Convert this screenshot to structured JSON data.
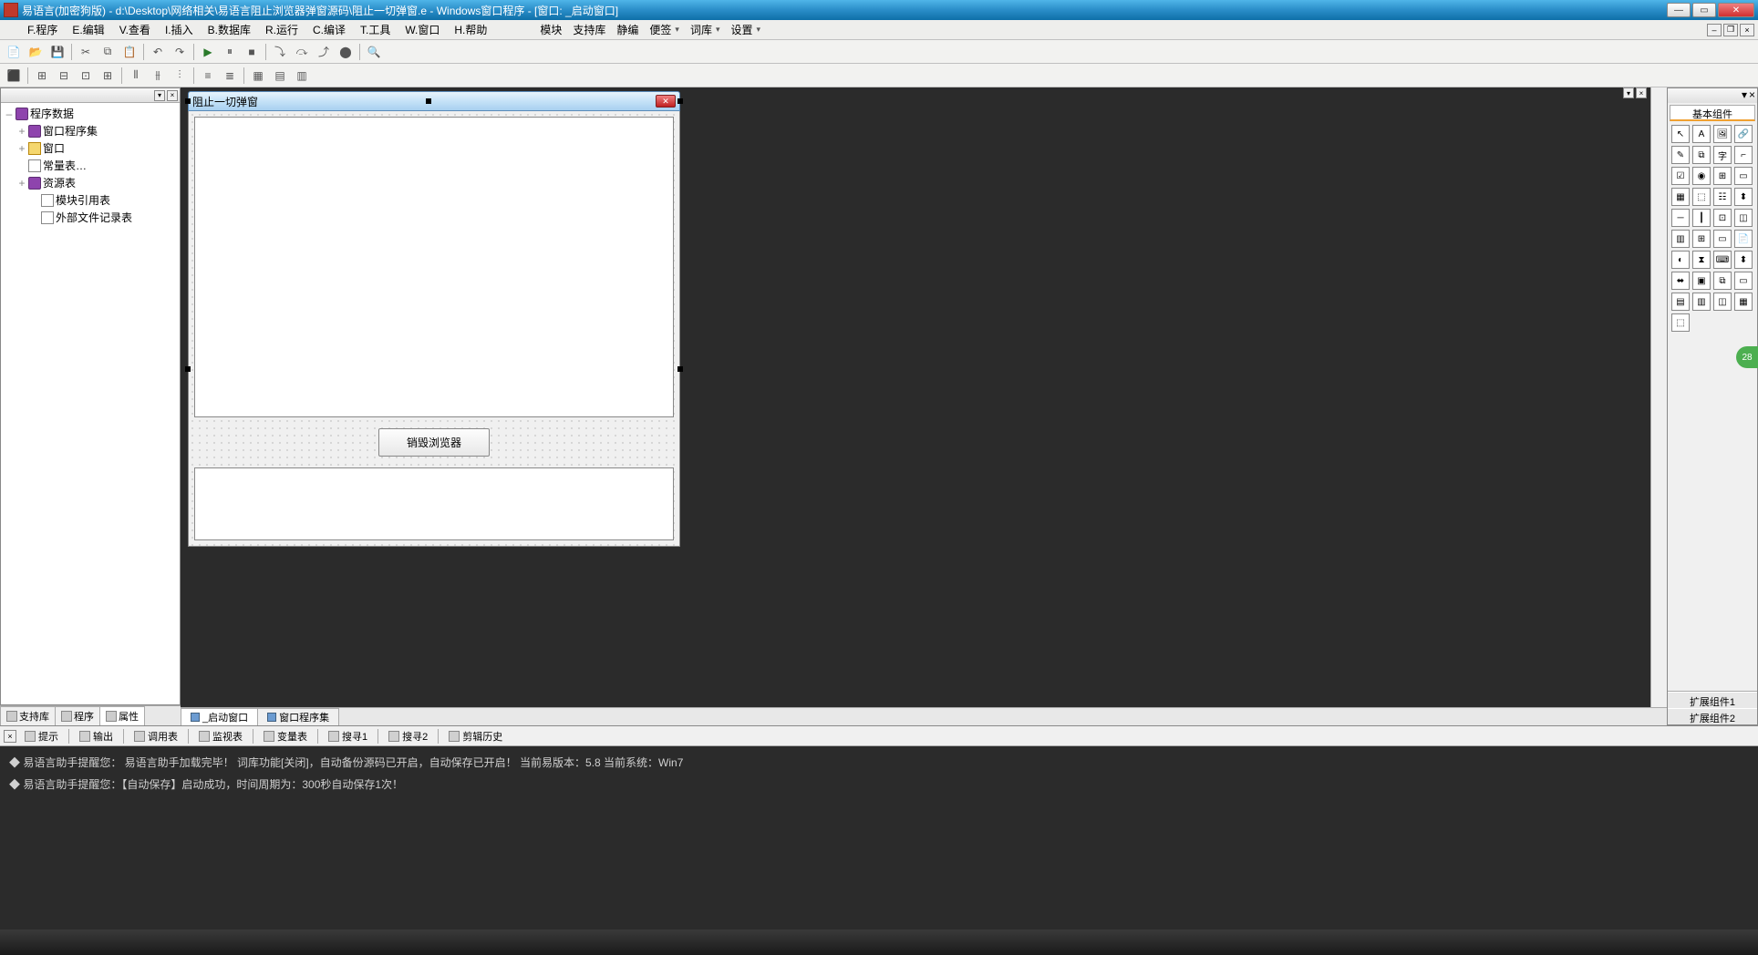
{
  "title": "易语言(加密狗版) - d:\\Desktop\\网络相关\\易语言阻止浏览器弹窗源码\\阻止一切弹窗.e - Windows窗口程序 - [窗口: _启动窗口]",
  "menu1": [
    "F.程序",
    "E.编辑",
    "V.查看",
    "I.插入",
    "B.数据库",
    "R.运行",
    "C.编译",
    "T.工具",
    "W.窗口",
    "H.帮助"
  ],
  "menu2": [
    {
      "label": "模块",
      "dd": false
    },
    {
      "label": "支持库",
      "dd": false
    },
    {
      "label": "静编",
      "dd": false
    },
    {
      "label": "便签",
      "dd": true
    },
    {
      "label": "词库",
      "dd": true
    },
    {
      "label": "设置",
      "dd": true
    }
  ],
  "tree": {
    "root": "程序数据",
    "items": [
      {
        "exp": "+",
        "icon": "db",
        "label": "窗口程序集",
        "ind": 1
      },
      {
        "exp": "+",
        "icon": "folder",
        "label": "窗口",
        "ind": 1
      },
      {
        "exp": "",
        "icon": "doc",
        "label": "常量表…",
        "ind": 1
      },
      {
        "exp": "+",
        "icon": "db",
        "label": "资源表",
        "ind": 1
      },
      {
        "exp": "",
        "icon": "doc",
        "label": "模块引用表",
        "ind": 2
      },
      {
        "exp": "",
        "icon": "doc",
        "label": "外部文件记录表",
        "ind": 2
      }
    ]
  },
  "left_tabs": [
    {
      "label": "支持库",
      "active": false
    },
    {
      "label": "程序",
      "active": false
    },
    {
      "label": "属性",
      "active": true
    }
  ],
  "form": {
    "title": "阻止一切弹窗",
    "button": "销毁浏览器"
  },
  "center_tabs": [
    {
      "label": "_启动窗口",
      "active": true
    },
    {
      "label": "窗口程序集",
      "active": false
    }
  ],
  "right": {
    "title": "基本组件",
    "ext1": "扩展组件1",
    "ext2": "扩展组件2"
  },
  "bottom_tabs": [
    "提示",
    "输出",
    "调用表",
    "监视表",
    "变量表",
    "搜寻1",
    "搜寻2",
    "剪辑历史"
  ],
  "output": [
    "易语言助手提醒您：  易语言助手加载完毕！  词库功能[关闭]，自动备份源码已开启，自动保存已开启！  当前易版本：5.8  当前系统：Win7",
    "易语言助手提醒您：【自动保存】启动成功，时间周期为：300秒自动保存1次！"
  ],
  "badge": "28"
}
